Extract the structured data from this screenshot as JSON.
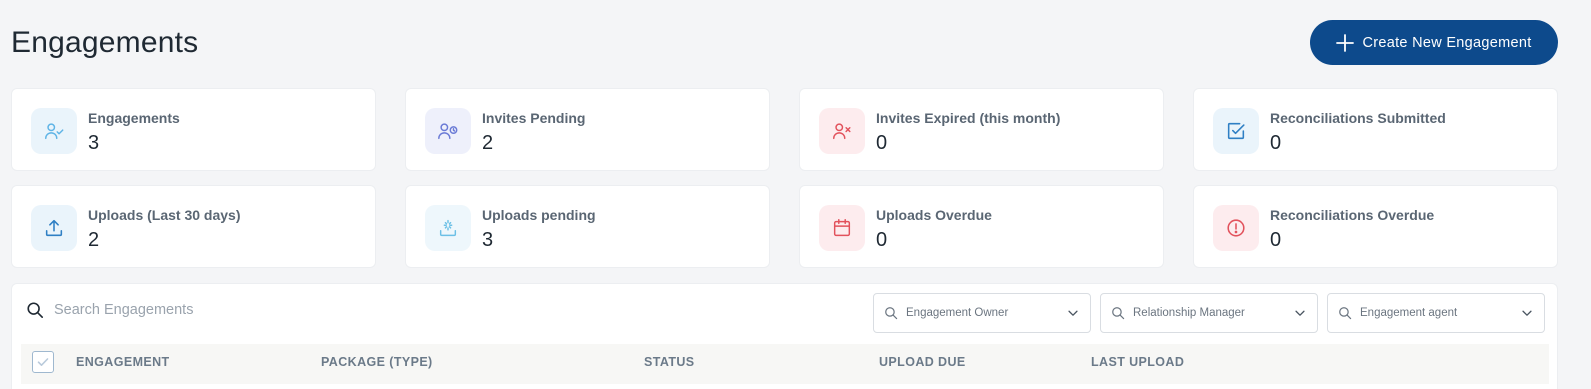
{
  "header": {
    "title": "Engagements",
    "create_button_label": "Create New Engagement"
  },
  "stats": [
    {
      "label": "Engagements",
      "value": "3",
      "icon": "user-check-icon",
      "color": "#5fb4e6"
    },
    {
      "label": "Invites Pending",
      "value": "2",
      "icon": "user-clock-icon",
      "color": "#6b7bd6"
    },
    {
      "label": "Invites Expired (this month)",
      "value": "0",
      "icon": "user-x-icon",
      "color": "#e2525c"
    },
    {
      "label": "Reconciliations Submitted",
      "value": "0",
      "icon": "check-square-icon",
      "color": "#2f7fc4"
    },
    {
      "label": "Uploads (Last 30 days)",
      "value": "2",
      "icon": "upload-icon",
      "color": "#2f7fc4"
    },
    {
      "label": "Uploads pending",
      "value": "3",
      "icon": "upload-pending-icon",
      "color": "#6cc0e6"
    },
    {
      "label": "Uploads Overdue",
      "value": "0",
      "icon": "calendar-icon",
      "color": "#e2525c"
    },
    {
      "label": "Reconciliations Overdue",
      "value": "0",
      "icon": "alert-circle-icon",
      "color": "#e2525c"
    }
  ],
  "search": {
    "placeholder": "Search Engagements"
  },
  "filters": [
    {
      "placeholder": "Engagement Owner"
    },
    {
      "placeholder": "Relationship Manager"
    },
    {
      "placeholder": "Engagement agent"
    }
  ],
  "table": {
    "columns": [
      "ENGAGEMENT",
      "PACKAGE (TYPE)",
      "STATUS",
      "UPLOAD DUE",
      "LAST UPLOAD"
    ]
  },
  "colors": {
    "primary": "#0d4a8c",
    "background": "#f4f5f7"
  }
}
